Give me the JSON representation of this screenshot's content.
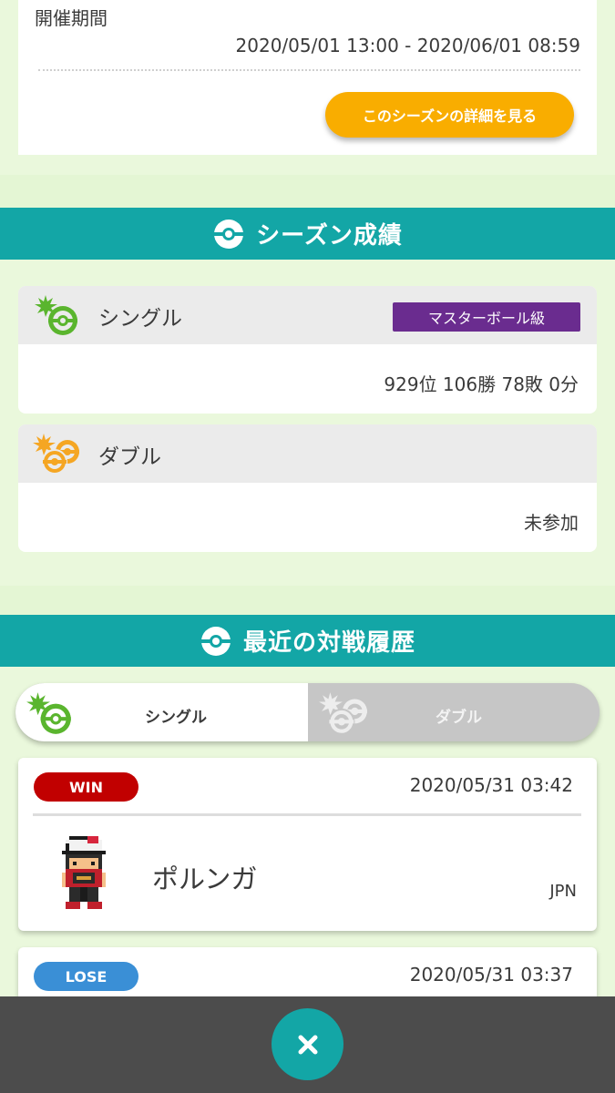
{
  "period": {
    "label": "開催期間",
    "range": "2020/05/01 13:00 - 2020/06/01 08:59",
    "detail_button": "このシーズンの詳細を見る"
  },
  "season_results": {
    "title": "シーズン成績",
    "single": {
      "mode": "シングル",
      "rank_badge": "マスターボール級",
      "record": "929位 106勝 78敗 0分"
    },
    "double": {
      "mode": "ダブル",
      "record": "未参加"
    }
  },
  "recent_battles": {
    "title": "最近の対戦履歴",
    "tabs": [
      {
        "label": "シングル",
        "selected": true
      },
      {
        "label": "ダブル",
        "selected": false
      }
    ],
    "battles": [
      {
        "outcome": "WIN",
        "time": "2020/05/31 03:42",
        "opponent": "ポルンガ",
        "region": "JPN"
      },
      {
        "outcome": "LOSE",
        "time": "2020/05/31 03:37"
      }
    ]
  },
  "colors": {
    "teal": "#13a6a6",
    "orange_button": "#f9ad00",
    "master_badge": "#6a2c8f",
    "win": "#c10000",
    "lose": "#3a8fd6",
    "single_green": "#5ab52e",
    "double_orange": "#f5a623"
  },
  "icons": {
    "section": "ball-icon",
    "single": "single-battle-icon",
    "double": "double-battle-icon",
    "close": "close-icon"
  }
}
